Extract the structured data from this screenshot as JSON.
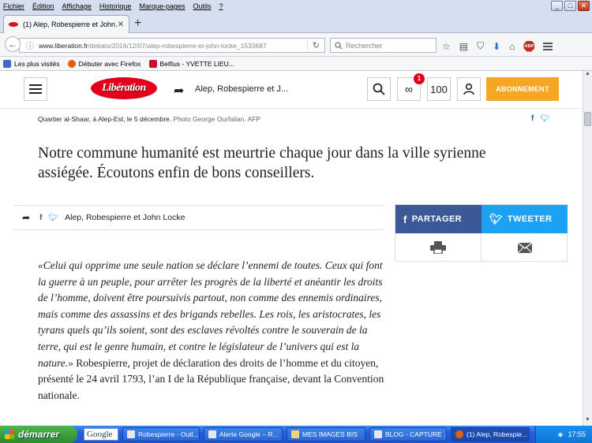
{
  "menubar": {
    "items": [
      "Fichier",
      "Édition",
      "Affichage",
      "Historique",
      "Marque-pages",
      "Outils",
      "?"
    ]
  },
  "window_buttons": {
    "minimize": "_",
    "maximize": "□",
    "close": "✕"
  },
  "tab": {
    "title": "(1) Alep, Robespierre et John..."
  },
  "navbar": {
    "url_domain": "www.liberation.fr",
    "url_path": "/debats/2016/12/07/alep-robespierre-et-john-locke_1533687",
    "search_placeholder": "Rechercher"
  },
  "bookmarks": [
    {
      "label": "Les plus visités",
      "color": "#3a6bc4"
    },
    {
      "label": "Débuter avec Firefox",
      "color": "#e66000"
    },
    {
      "label": "Belfius - YVETTE LIEU...",
      "color": "#c8102e"
    }
  ],
  "site_header": {
    "logo_text": "Libération",
    "article_title": "Alep, Robespierre et J...",
    "badge_count": "1",
    "comments_count": "100",
    "subscribe_label": "ABONNEMENT"
  },
  "caption": {
    "text": "Quartier al-Shaar, à Alep-Est, le 5 décembre.",
    "credit": "Photo George Ourfalian. AFP"
  },
  "subtitle": "Notre commune humanité est meurtrie chaque jour dans la ville syrienne assiégée. Écoutons enfin de bons conseillers.",
  "share_bar": {
    "title": "Alep, Robespierre et John Locke"
  },
  "share_box": {
    "facebook_label": "PARTAGER",
    "twitter_label": "TWEETER"
  },
  "article": {
    "quote": "«Celui qui opprime une seule nation se déclare l’ennemi de toutes. Ceux qui font la guerre à un peuple, pour arrêter les progrès de la liberté et anéantir les droits de l’homme, doivent être poursuivis partout, non comme des ennemis ordinaires, mais comme des assassins et des brigands rebelles. Les rois, les aristocrates, les tyrans quels qu’ils soient, sont des esclaves révoltés contre le souverain de la terre, qui est le genre humain, et contre le législateur de l’univers qui est la nature.»",
    "attribution": " Robespierre, projet de déclaration des droits de l’homme et du citoyen, présenté le 24 avril 1793, l’an I de la République française, devant la Convention nationale."
  },
  "taskbar": {
    "start_label": "démarrer",
    "google_label": "Google",
    "tasks": [
      "Robespierre - Outl...",
      "Alerte Google – R...",
      "MES IMAGES BIS",
      "BLOG - CAPTURE ...",
      "(1) Alep, Robespie..."
    ],
    "clock": "17:55"
  },
  "colors": {
    "liberation_red": "#e3001b",
    "subscribe_orange": "#f5a623",
    "facebook_blue": "#3b5998",
    "twitter_blue": "#1da1f2"
  }
}
